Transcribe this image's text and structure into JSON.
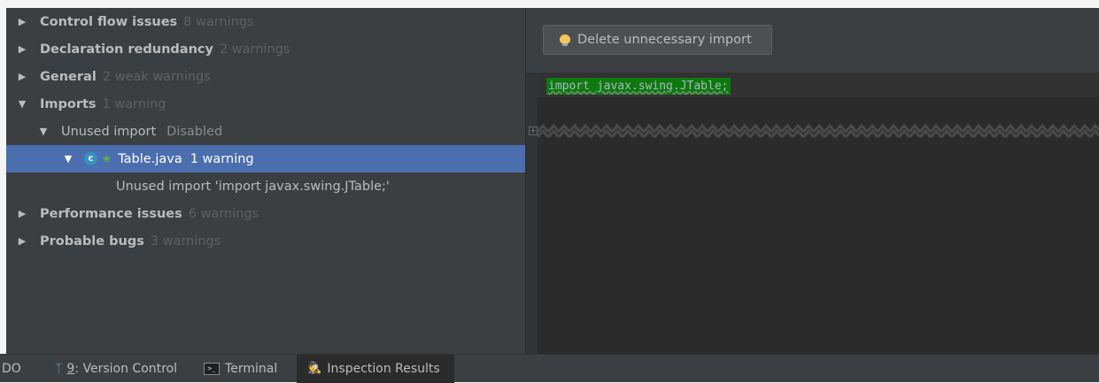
{
  "tree": {
    "rows": [
      {
        "label": "Control flow issues",
        "count": "8 warnings"
      },
      {
        "label": "Declaration redundancy",
        "count": "2 warnings"
      },
      {
        "label": "General",
        "count": "2 weak warnings"
      },
      {
        "label": "Imports",
        "count": "1 warning"
      },
      {
        "label": "Unused import",
        "count": "Disabled"
      },
      {
        "label": "Table.java",
        "count": "1 warning"
      },
      {
        "label": "Unused import 'import javax.swing.JTable;'"
      },
      {
        "label": "Performance issues",
        "count": "6 warnings"
      },
      {
        "label": "Probable bugs",
        "count": "3 warnings"
      }
    ],
    "class_icon_letter": "c"
  },
  "quickfix": {
    "label": "Delete unnecessary import"
  },
  "editor": {
    "code_line": "import javax.swing.JTable;",
    "fold_marker": "+"
  },
  "statusbar": {
    "tabs": [
      {
        "label": "DO"
      },
      {
        "mnemonic": "9",
        "label": ": Version Control"
      },
      {
        "label": "Terminal"
      },
      {
        "label": "Inspection Results"
      }
    ],
    "terminal_glyph": ">_"
  },
  "colors": {
    "panel": "#3c3f41",
    "editor": "#2b2b2b",
    "selection": "#4b6eaf",
    "code_highlight": "#0e7a0e",
    "class_icon": "#3592c4"
  },
  "icons": [
    "expand-arrow-icon",
    "collapse-arrow-icon",
    "class-icon",
    "leaf-icon",
    "lightbulb-icon",
    "branch-icon",
    "terminal-icon",
    "inspector-icon"
  ]
}
